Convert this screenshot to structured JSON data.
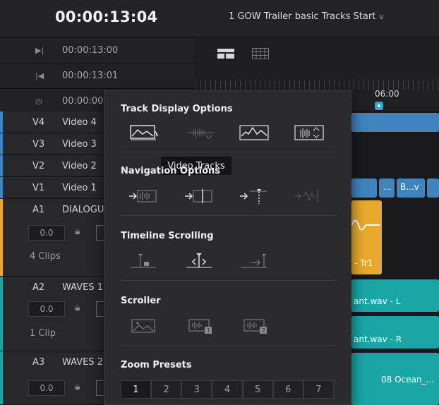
{
  "timecode": "00:00:13:04",
  "timeline_name": "1 GOW Trailer basic Tracks Start",
  "header_rows": [
    {
      "icon": "play-to-end-icon",
      "glyph": "▶|",
      "timecode": "00:00:13:00"
    },
    {
      "icon": "go-to-start-icon",
      "glyph": "|◀",
      "timecode": "00:00:13:01"
    },
    {
      "icon": "clock-icon",
      "glyph": "◷",
      "timecode": "00:00:00"
    }
  ],
  "ruler": {
    "label": "06:00"
  },
  "tracks": {
    "v4": {
      "id": "V4",
      "name": "Video 4"
    },
    "v3": {
      "id": "V3",
      "name": "Video 3"
    },
    "v2": {
      "id": "V2",
      "name": "Video 2"
    },
    "v1": {
      "id": "V1",
      "name": "Video 1"
    },
    "a1": {
      "id": "A1",
      "name": "DIALOGU",
      "volume": "0.0",
      "clips": "4 Clips"
    },
    "a2": {
      "id": "A2",
      "name": "WAVES 1",
      "volume": "0.0",
      "clips": "1 Clip"
    },
    "a3": {
      "id": "A3",
      "name": "WAVES 2",
      "volume": "0.0"
    }
  },
  "timeline_clips": {
    "v1_dots": "...",
    "v1_b": "B...v",
    "a1_clip": "- Tr1",
    "a2_clip_l": "ant.wav - L",
    "a2_clip_r": "ant.wav - R",
    "a3_clip": "08 Ocean_..."
  },
  "popup": {
    "track_display_title": "Track Display Options",
    "navigation_title": "Navigation Options",
    "scrolling_title": "Timeline Scrolling",
    "scroller_title": "Scroller",
    "zoom_title": "Zoom Presets",
    "tooltip": "Video Tracks",
    "zoom_presets": [
      "1",
      "2",
      "3",
      "4",
      "5",
      "6",
      "7"
    ]
  },
  "colors": {
    "video_track": "#3f84bf",
    "dialogue_track": "#e8a92c",
    "waves_track": "#1aa5a6",
    "playhead": "#2aa9d8"
  }
}
